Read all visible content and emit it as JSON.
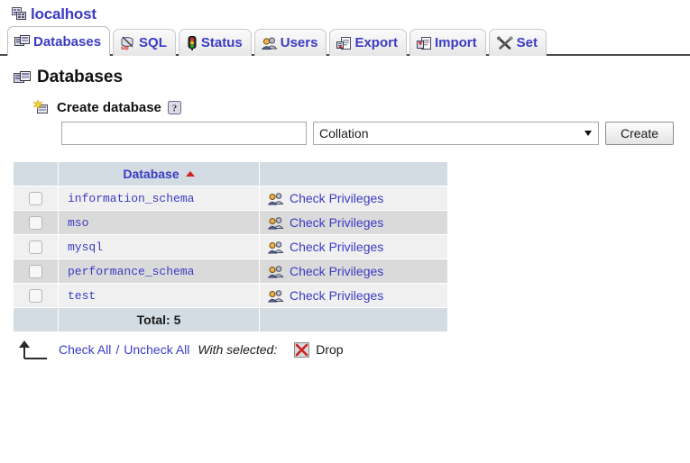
{
  "server": {
    "icon": "server-icon",
    "name": "localhost"
  },
  "tabs": [
    {
      "id": "databases",
      "label": "Databases",
      "icon": "databases-icon",
      "active": true
    },
    {
      "id": "sql",
      "label": "SQL",
      "icon": "sql-icon",
      "active": false
    },
    {
      "id": "status",
      "label": "Status",
      "icon": "traffic-light-icon",
      "active": false
    },
    {
      "id": "users",
      "label": "Users",
      "icon": "users-icon",
      "active": false
    },
    {
      "id": "export",
      "label": "Export",
      "icon": "export-icon",
      "active": false
    },
    {
      "id": "import",
      "label": "Import",
      "icon": "import-icon",
      "active": false
    },
    {
      "id": "settings",
      "label": "Set",
      "icon": "tools-icon",
      "active": false
    }
  ],
  "page": {
    "heading": "Databases",
    "heading_icon": "databases-icon"
  },
  "create": {
    "legend": "Create database",
    "legend_icon": "new-database-icon",
    "help_icon": "help-icon",
    "name_value": "",
    "name_placeholder": "",
    "collation_selected": "Collation",
    "collation_options": [
      "Collation"
    ],
    "create_label": "Create"
  },
  "table": {
    "columns": [
      "",
      "Database",
      ""
    ],
    "sort_column": "Database",
    "sort_direction": "asc",
    "priv_icon": "privileges-icon",
    "priv_label": "Check Privileges",
    "rows": [
      {
        "name": "information_schema",
        "privileges": "Check Privileges"
      },
      {
        "name": "mso",
        "privileges": "Check Privileges"
      },
      {
        "name": "mysql",
        "privileges": "Check Privileges"
      },
      {
        "name": "performance_schema",
        "privileges": "Check Privileges"
      },
      {
        "name": "test",
        "privileges": "Check Privileges"
      }
    ],
    "total_label": "Total: 5"
  },
  "actions": {
    "arrow_icon": "arrow-up-from-line-icon",
    "check_all": "Check All",
    "separator": "/",
    "uncheck_all": "Uncheck All",
    "with_selected": "With selected:",
    "drop_icon": "drop-x-icon",
    "drop_label": "Drop"
  },
  "colors": {
    "link": "#3b3bc4",
    "header_bg": "#d3dce3",
    "row_odd": "#f0f0f0",
    "row_even": "#dadada",
    "sort_arrow": "#cc2222",
    "drop_x": "#cc2222"
  }
}
